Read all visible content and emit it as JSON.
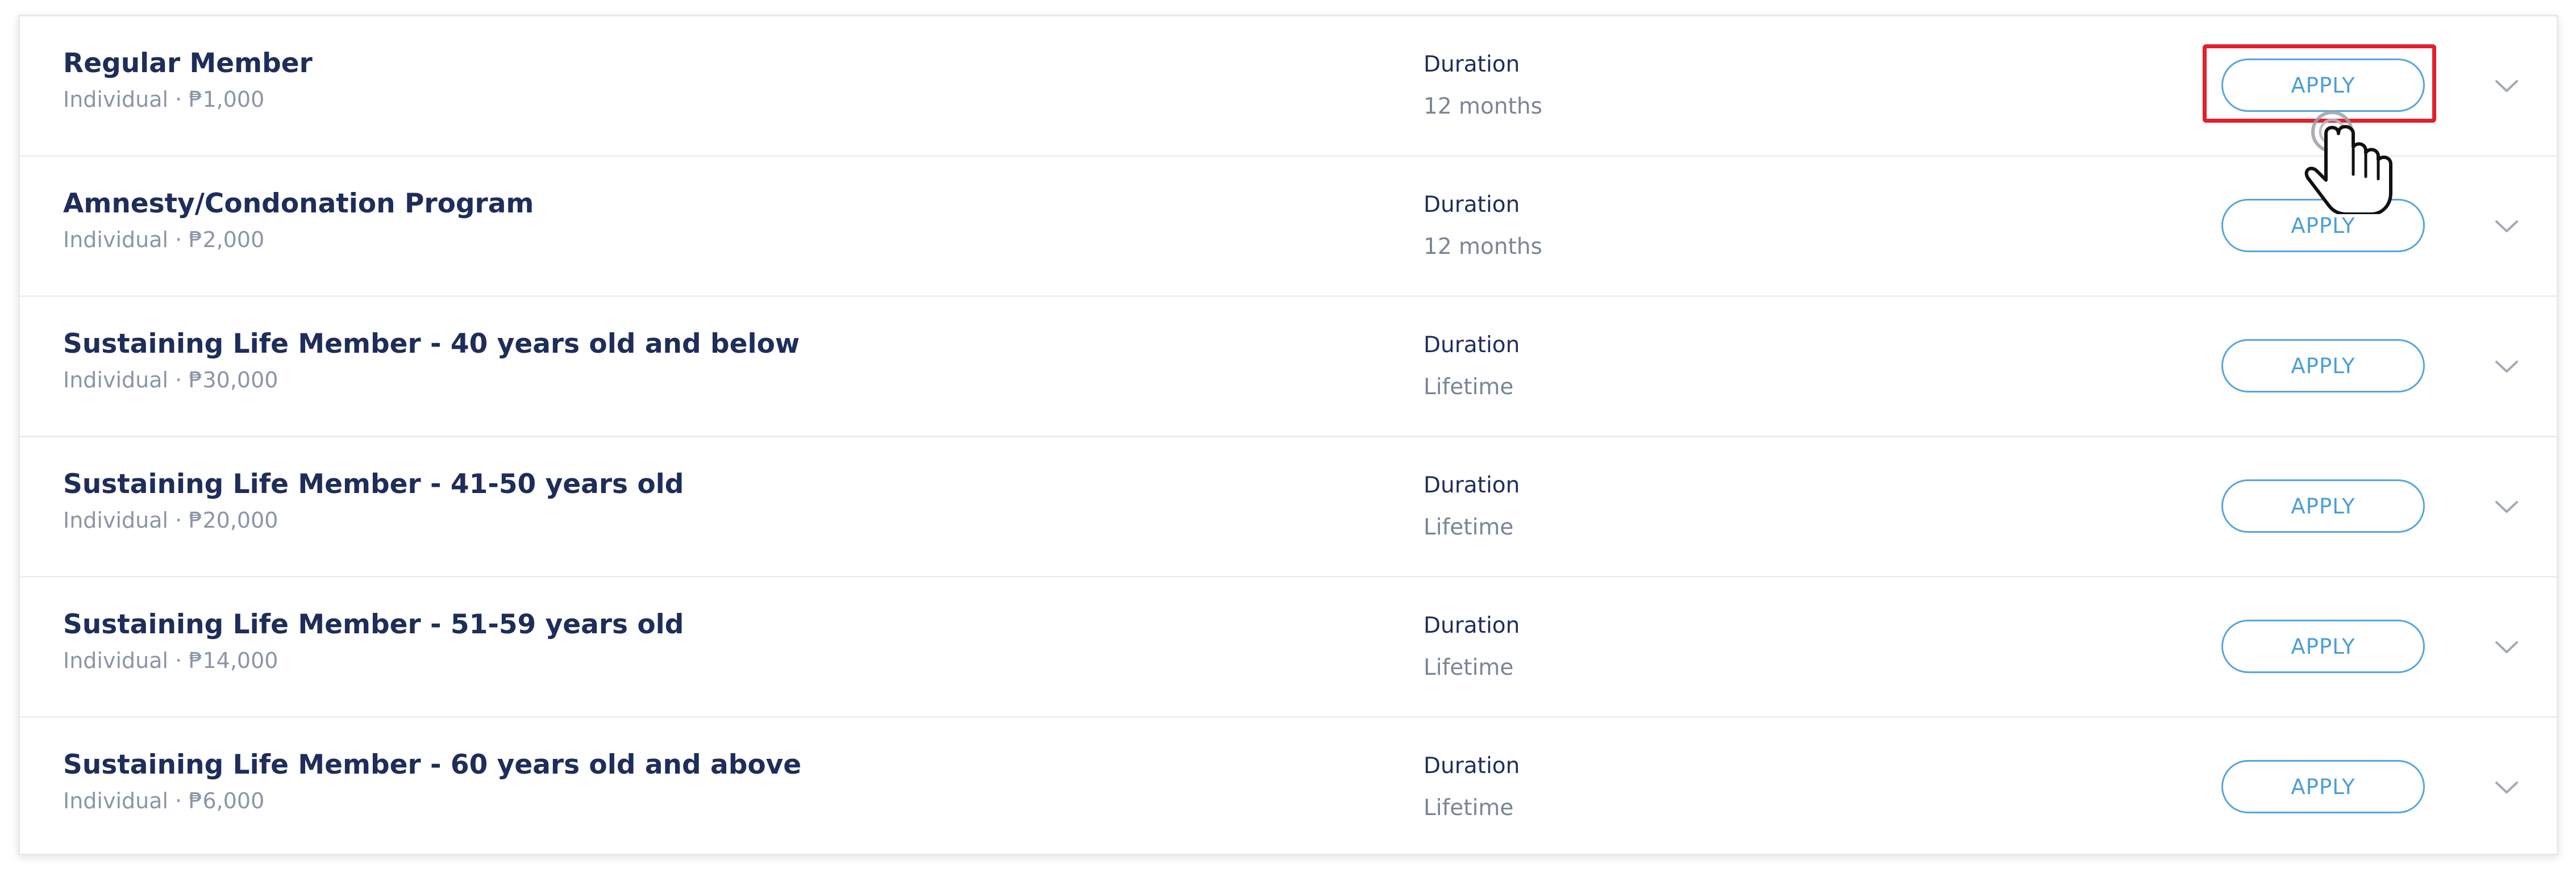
{
  "section": {
    "duration_label": "Duration",
    "apply_label": "APPLY"
  },
  "plans": [
    {
      "name": "Regular Member",
      "subtitle": "Individual · ₱1,000",
      "duration": "12 months"
    },
    {
      "name": "Amnesty/Condonation Program",
      "subtitle": "Individual · ₱2,000",
      "duration": "12 months"
    },
    {
      "name": "Sustaining Life Member - 40 years old and below",
      "subtitle": "Individual · ₱30,000",
      "duration": "Lifetime"
    },
    {
      "name": "Sustaining Life Member - 41-50 years old",
      "subtitle": "Individual · ₱20,000",
      "duration": "Lifetime"
    },
    {
      "name": "Sustaining Life Member - 51-59 years old",
      "subtitle": "Individual · ₱14,000",
      "duration": "Lifetime"
    },
    {
      "name": "Sustaining Life Member - 60 years old and above",
      "subtitle": "Individual · ₱6,000",
      "duration": "Lifetime"
    }
  ],
  "icons": {
    "expand": "chevron-down-icon",
    "pointer": "hand-pointer-icon"
  },
  "colors": {
    "title": "#1e2d5a",
    "muted": "#8b95a7",
    "accent": "#4a9ed8",
    "highlight": "#e31e2d"
  }
}
